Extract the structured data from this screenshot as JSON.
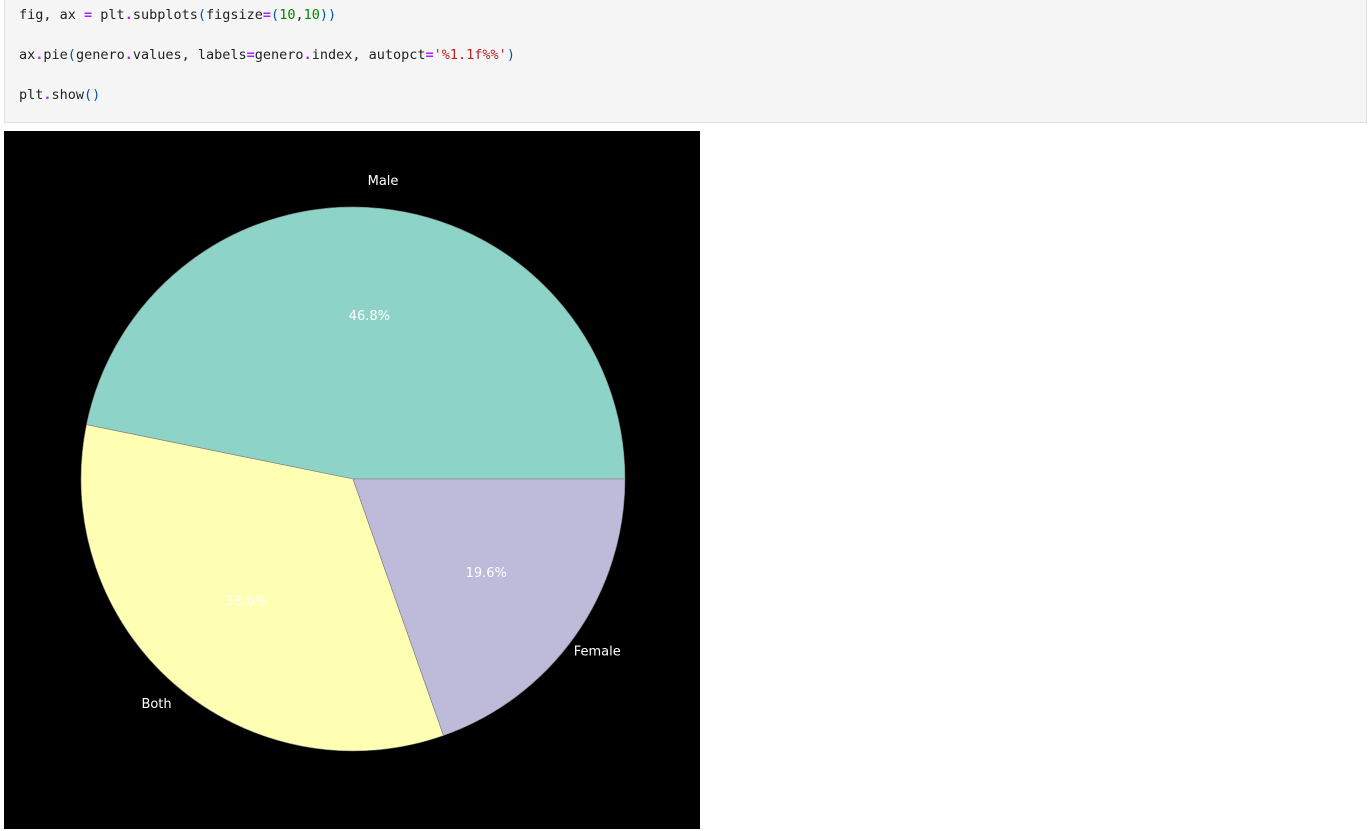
{
  "code_cell": {
    "lines": [
      [
        {
          "t": "fig, ax ",
          "c": "plain"
        },
        {
          "t": "=",
          "c": "op"
        },
        {
          "t": " plt",
          "c": "plain"
        },
        {
          "t": ".",
          "c": "op"
        },
        {
          "t": "subplots",
          "c": "plain"
        },
        {
          "t": "(",
          "c": "paren"
        },
        {
          "t": "figsize",
          "c": "plain"
        },
        {
          "t": "=",
          "c": "op"
        },
        {
          "t": "(",
          "c": "paren"
        },
        {
          "t": "10",
          "c": "num"
        },
        {
          "t": ",",
          "c": "plain"
        },
        {
          "t": "10",
          "c": "num"
        },
        {
          "t": "))",
          "c": "paren"
        }
      ],
      [
        {
          "t": "ax",
          "c": "plain"
        },
        {
          "t": ".",
          "c": "op"
        },
        {
          "t": "pie",
          "c": "plain"
        },
        {
          "t": "(",
          "c": "paren"
        },
        {
          "t": "genero",
          "c": "plain"
        },
        {
          "t": ".",
          "c": "op"
        },
        {
          "t": "values, labels",
          "c": "plain"
        },
        {
          "t": "=",
          "c": "op"
        },
        {
          "t": "genero",
          "c": "plain"
        },
        {
          "t": ".",
          "c": "op"
        },
        {
          "t": "index, autopct",
          "c": "plain"
        },
        {
          "t": "=",
          "c": "op"
        },
        {
          "t": "'%1.1f%%'",
          "c": "str"
        },
        {
          "t": ")",
          "c": "paren"
        }
      ],
      [
        {
          "t": "plt",
          "c": "plain"
        },
        {
          "t": ".",
          "c": "op"
        },
        {
          "t": "show",
          "c": "plain"
        },
        {
          "t": "()",
          "c": "paren"
        }
      ]
    ]
  },
  "chart_data": {
    "type": "pie",
    "categories": [
      "Male",
      "Both",
      "Female"
    ],
    "values": [
      46.8,
      33.6,
      19.6
    ],
    "value_labels": [
      "46.8%",
      "33.6%",
      "19.6%"
    ],
    "colors": [
      "#8dd3c7",
      "#ffffb3",
      "#bebada"
    ],
    "background": "#000000",
    "start_angle_deg": 0,
    "direction": "counterclockwise"
  }
}
